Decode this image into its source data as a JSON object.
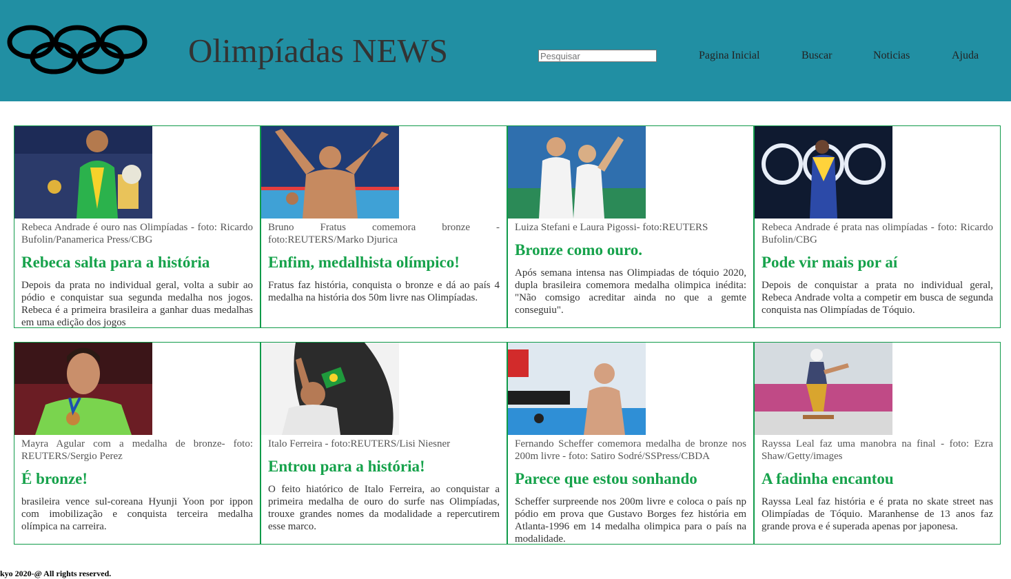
{
  "header": {
    "title": "Olimpíadas NEWS",
    "search_placeholder": "Pesquisar",
    "nav": [
      "Pagina Inicial",
      "Buscar",
      "Noticias",
      "Ajuda"
    ]
  },
  "articles": [
    {
      "caption": "Rebeca Andrade é ouro nas Olimpíadas - foto: Ricardo Bufolin/Panamerica Press/CBG",
      "headline": "Rebeca salta para a história",
      "description": "Depois da prata no individual geral, volta a subir ao pódio e conquistar sua segunda medalha nos jogos. Rebeca é a primeira brasileira a ganhar duas medalhas em uma edição dos jogos"
    },
    {
      "caption": "Bruno Fratus comemora bronze - foto:REUTERS/Marko Djurica",
      "headline": "Enfim, medalhista olímpico!",
      "description": "Fratus faz história, conquista o bronze e dá ao país 4 medalha na história dos 50m livre nas Olimpíadas."
    },
    {
      "caption": "Luiza Stefani e Laura Pigossi- foto:REUTERS",
      "headline": "Bronze como ouro.",
      "description": "Após semana intensa nas Olimpiadas de tóquio 2020, dupla brasileira comemora medalha olimpica inédita: \"Não comsigo acreditar ainda no que a gemte conseguiu\"."
    },
    {
      "caption": "Rebeca Andrade é prata nas olimpíadas - foto: Ricardo Bufolin/CBG",
      "headline": "Pode vir mais por aí",
      "description": "Depois de conquistar a prata no individual geral, Rebeca Andrade volta a competir em busca de segunda conquista nas Olimpíadas de Tóquio."
    },
    {
      "caption": "Mayra Agular com a medalha de bronze- foto: REUTERS/Sergio Perez",
      "headline": "É bronze!",
      "description": "brasileira vence sul-coreana Hyunji Yoon por ippon com imobilização e conquista terceira medalha olímpica na carreira."
    },
    {
      "caption": "Italo Ferreira - foto:REUTERS/Lisi Niesner",
      "headline": "Entrou para a história!",
      "description": "O feito hiatórico de Italo Ferreira, ao conquistar a primeira medalha de ouro do surfe nas Olimpíadas, trouxe grandes nomes da modalidade a repercutirem esse marco."
    },
    {
      "caption": "Fernando Scheffer comemora medalha de bronze nos 200m livre - foto: Satiro Sodré/SSPress/CBDA",
      "headline": "Parece que estou sonhando",
      "description": "Scheffer surpreende nos 200m livre e coloca o país np pódio em prova que Gustavo Borges fez história em Atlanta-1996 em 14 medalha olimpica para o país na modalidade."
    },
    {
      "caption": "Rayssa Leal faz uma manobra na final - foto: Ezra Shaw/Getty/images",
      "headline": "A fadinha encantou",
      "description": "Rayssa Leal faz história e é prata no skate street nas Olimpíadas de Tóquio. Maranhense de 13 anos faz grande prova e é superada apenas por japonesa."
    }
  ],
  "footer": "kyo 2020-@ All rights reserved."
}
